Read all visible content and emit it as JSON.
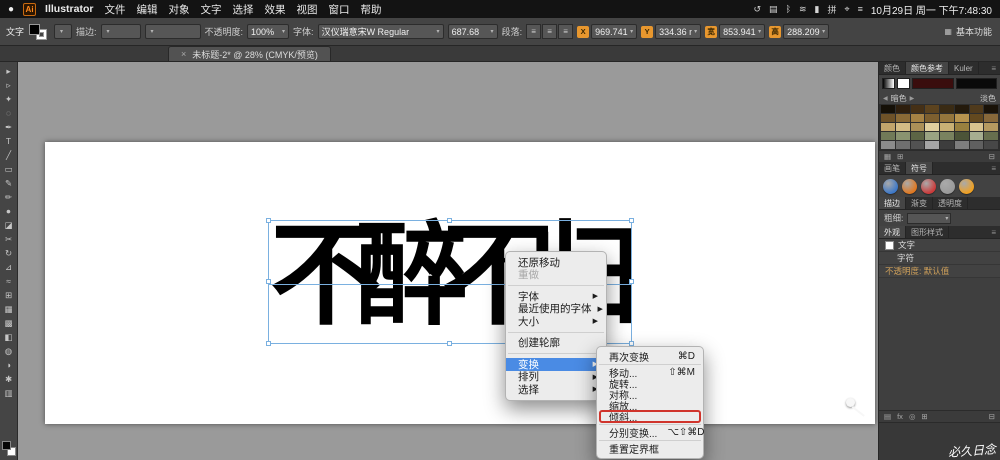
{
  "colors": {
    "accent_blue": "#4a8be4",
    "annotation_red": "#d0342c",
    "selection_blue": "#7ab0e0",
    "artboard_white": "#ffffff",
    "canvas_gray": "#9a9a9a"
  },
  "menubar": {
    "apple_glyph": "●",
    "app_badge": "Ai",
    "items": [
      "Illustrator",
      "文件",
      "编辑",
      "对象",
      "文字",
      "选择",
      "效果",
      "视图",
      "窗口",
      "帮助"
    ],
    "status_icons": [
      {
        "name": "backup-status-icon",
        "glyph": "↺"
      },
      {
        "name": "display-icon",
        "glyph": "▤"
      },
      {
        "name": "bluetooth-icon",
        "glyph": "ᛒ"
      },
      {
        "name": "wifi-icon",
        "glyph": "≋"
      },
      {
        "name": "battery-icon",
        "glyph": "▮"
      },
      {
        "name": "input-method-icon",
        "glyph": "拼"
      },
      {
        "name": "spotlight-icon",
        "glyph": "⌖"
      },
      {
        "name": "notification-center-icon",
        "glyph": "≡"
      }
    ],
    "clock": "10月29日 周一 下午7:48:30"
  },
  "controlbar": {
    "object_label": "文字",
    "stroke_label": "描边:",
    "opacity_label": "不透明度:",
    "opacity_value": "100%",
    "font_label": "字体:",
    "font_value": "汉仪瑞意宋W Regular",
    "font_size_value": "687.68",
    "paragraph_label": "段落:",
    "align_icons": [
      {
        "name": "align-left-icon",
        "glyph": "≡"
      },
      {
        "name": "align-center-icon",
        "glyph": "≡"
      },
      {
        "name": "align-right-icon",
        "glyph": "≡"
      }
    ],
    "x_tag": "X",
    "x_value": "969.741",
    "y_tag": "Y",
    "y_value": "334.36 m",
    "w_tag": "宽",
    "w_value": "853.941",
    "h_tag": "高",
    "h_value": "288.209",
    "workspace_label": "基本功能"
  },
  "document": {
    "tab_title": "未标题-2* @ 28% (CMYK/预览)",
    "close_glyph": "×"
  },
  "toolbar": {
    "tools": [
      {
        "name": "selection-tool",
        "glyph": "▸"
      },
      {
        "name": "direct-selection-tool",
        "glyph": "▹"
      },
      {
        "name": "magic-wand-tool",
        "glyph": "✦"
      },
      {
        "name": "lasso-tool",
        "glyph": "◌"
      },
      {
        "name": "pen-tool",
        "glyph": "✒"
      },
      {
        "name": "type-tool",
        "glyph": "T"
      },
      {
        "name": "line-segment-tool",
        "glyph": "╱"
      },
      {
        "name": "rectangle-tool",
        "glyph": "▭"
      },
      {
        "name": "paintbrush-tool",
        "glyph": "✎"
      },
      {
        "name": "pencil-tool",
        "glyph": "✏"
      },
      {
        "name": "blob-brush-tool",
        "glyph": "●"
      },
      {
        "name": "eraser-tool",
        "glyph": "◪"
      },
      {
        "name": "scissors-tool",
        "glyph": "✂"
      },
      {
        "name": "rotate-tool",
        "glyph": "↻"
      },
      {
        "name": "scale-tool",
        "glyph": "⊿"
      },
      {
        "name": "width-tool",
        "glyph": "≈"
      },
      {
        "name": "free-transform-tool",
        "glyph": "⊞"
      },
      {
        "name": "perspective-grid-tool",
        "glyph": "▦"
      },
      {
        "name": "mesh-tool",
        "glyph": "▩"
      },
      {
        "name": "gradient-tool",
        "glyph": "◧"
      },
      {
        "name": "eyedropper-tool",
        "glyph": "◍"
      },
      {
        "name": "blend-tool",
        "glyph": "◑"
      },
      {
        "name": "symbol-sprayer-tool",
        "glyph": "✱"
      },
      {
        "name": "column-graph-tool",
        "glyph": "▥"
      }
    ]
  },
  "canvas": {
    "text": "不醉不归"
  },
  "context_menu": {
    "items": [
      {
        "type": "item",
        "label": "还原移动"
      },
      {
        "type": "item",
        "label": "重做",
        "disabled": true
      },
      {
        "type": "sep"
      },
      {
        "type": "item",
        "label": "字体",
        "submenu": true
      },
      {
        "type": "item",
        "label": "最近使用的字体",
        "submenu": true
      },
      {
        "type": "item",
        "label": "大小",
        "submenu": true
      },
      {
        "type": "sep"
      },
      {
        "type": "item",
        "label": "创建轮廓"
      },
      {
        "type": "sep"
      },
      {
        "type": "item",
        "label": "变换",
        "submenu": true,
        "selected": true
      },
      {
        "type": "item",
        "label": "排列",
        "submenu": true
      },
      {
        "type": "item",
        "label": "选择",
        "submenu": true
      }
    ]
  },
  "transform_submenu": {
    "items": [
      {
        "type": "item",
        "label": "再次变换",
        "shortcut": "⌘D"
      },
      {
        "type": "sep"
      },
      {
        "type": "item",
        "label": "移动...",
        "shortcut": "⇧⌘M"
      },
      {
        "type": "item",
        "label": "旋转..."
      },
      {
        "type": "item",
        "label": "对称..."
      },
      {
        "type": "item",
        "label": "缩放..."
      },
      {
        "type": "item",
        "label": "倾斜...",
        "annotated": true
      },
      {
        "type": "sep"
      },
      {
        "type": "item",
        "label": "分别变换...",
        "shortcut": "⌥⇧⌘D"
      },
      {
        "type": "sep"
      },
      {
        "type": "item",
        "label": "重置定界框"
      }
    ]
  },
  "panels": {
    "color": {
      "tab_color": "颜色",
      "tab_guide": "颜色参考",
      "tab_kuler": "Kuler",
      "dark_label": "暗色",
      "light_label": "淡色",
      "swatch_grid": [
        "#151007",
        "#2e1f0e",
        "#453016",
        "#5c431f",
        "#3a2b14",
        "#241a0c",
        "#4f3a1c",
        "#191208",
        "#6e5228",
        "#8a6a36",
        "#a58244",
        "#7d5f2f",
        "#95763c",
        "#b8944e",
        "#63491f",
        "#87683a",
        "#c2a56b",
        "#d4bc85",
        "#ab9058",
        "#e0cf9f",
        "#c9b175",
        "#99803f",
        "#d8c48f",
        "#b59a60",
        "#717a58",
        "#8a9370",
        "#5d6545",
        "#9aa383",
        "#79825f",
        "#4c5438",
        "#a6ae90",
        "#676f4e",
        "#8c8c8c",
        "#6f6f6f",
        "#525252",
        "#a5a5a5",
        "#3d3d3d",
        "#7d7d7d",
        "#606060",
        "#474747"
      ]
    },
    "color_footer_icons": [
      {
        "name": "color-group-icon",
        "glyph": "▦"
      },
      {
        "name": "save-color-group-icon",
        "glyph": "⊞"
      },
      {
        "name": "trash-icon",
        "glyph": "⊟"
      }
    ],
    "symbols": {
      "tab_brushes": "画笔",
      "tab_symbols": "符号",
      "items": [
        {
          "name": "symbol-blue-orb",
          "color": "#3d78c8"
        },
        {
          "name": "symbol-orange-orb",
          "color": "#e07820"
        },
        {
          "name": "symbol-red-flower",
          "color": "#cc3a3a"
        },
        {
          "name": "symbol-gear",
          "color": "#9a9a9a"
        },
        {
          "name": "symbol-sun",
          "color": "#f0a020"
        }
      ]
    },
    "stroke": {
      "tab_stroke": "描边",
      "tab_gradient": "渐变",
      "tab_transparency": "透明度",
      "weight_label": "粗细:"
    },
    "appearance": {
      "tab_appearance": "外观",
      "tab_styles": "图形样式",
      "rows": [
        {
          "label": "文字",
          "swatch": "#ffffff"
        },
        {
          "label": "字符",
          "indent": true
        },
        {
          "label": "不透明度: 默认值",
          "muted": true
        }
      ],
      "footer_icons": [
        {
          "name": "new-stroke-icon",
          "glyph": "▤"
        },
        {
          "name": "add-effect-icon",
          "glyph": "fx"
        },
        {
          "name": "clear-appearance-icon",
          "glyph": "◎"
        },
        {
          "name": "duplicate-item-icon",
          "glyph": "⊞"
        },
        {
          "name": "delete-item-icon",
          "glyph": "⊟"
        }
      ]
    }
  },
  "watermark": "必久日念"
}
